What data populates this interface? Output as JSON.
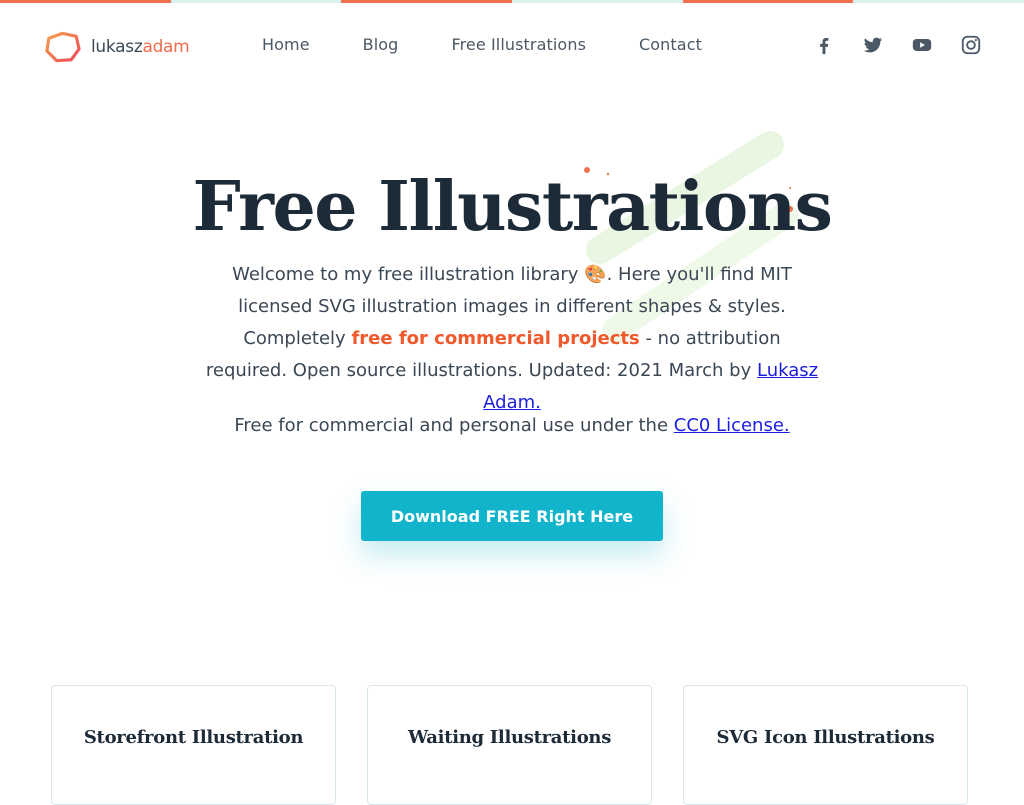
{
  "logo": {
    "part1": "lukasz",
    "part2": "adam"
  },
  "nav": [
    {
      "label": "Home"
    },
    {
      "label": "Blog"
    },
    {
      "label": "Free Illustrations"
    },
    {
      "label": "Contact"
    }
  ],
  "social": [
    "facebook-icon",
    "twitter-icon",
    "youtube-icon",
    "instagram-icon"
  ],
  "hero": {
    "title": "Free Illustrations",
    "intro1": "Welcome to my free illustration library ",
    "emoji": "🎨",
    "intro2": ". Here you'll find MIT licensed SVG illustration images in different shapes & styles. Completely ",
    "highlight": "free for commercial projects",
    "intro3": " - no attribution required. Open source illustrations. Updated: 2021 March by ",
    "author_link": "Lukasz Adam.",
    "license_text": "Free for commercial and personal use under the ",
    "license_link": "CC0 License.",
    "cta": "Download FREE Right Here"
  },
  "cards": [
    {
      "title": "Storefront Illustration"
    },
    {
      "title": "Waiting Illustrations"
    },
    {
      "title": "SVG Icon Illustrations"
    }
  ],
  "colors": {
    "accent": "#f26b4d",
    "cta": "#12b4cc",
    "heading": "#1d2a37",
    "link": "#1a1de0"
  }
}
